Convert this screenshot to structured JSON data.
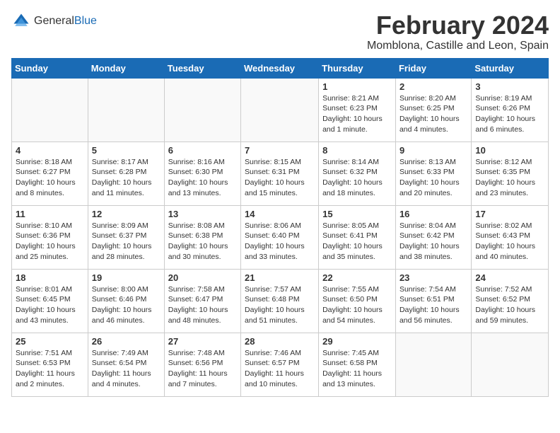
{
  "header": {
    "logo_general": "General",
    "logo_blue": "Blue",
    "month_year": "February 2024",
    "location": "Momblona, Castille and Leon, Spain"
  },
  "weekdays": [
    "Sunday",
    "Monday",
    "Tuesday",
    "Wednesday",
    "Thursday",
    "Friday",
    "Saturday"
  ],
  "weeks": [
    [
      {
        "day": "",
        "info": ""
      },
      {
        "day": "",
        "info": ""
      },
      {
        "day": "",
        "info": ""
      },
      {
        "day": "",
        "info": ""
      },
      {
        "day": "1",
        "info": "Sunrise: 8:21 AM\nSunset: 6:23 PM\nDaylight: 10 hours\nand 1 minute."
      },
      {
        "day": "2",
        "info": "Sunrise: 8:20 AM\nSunset: 6:25 PM\nDaylight: 10 hours\nand 4 minutes."
      },
      {
        "day": "3",
        "info": "Sunrise: 8:19 AM\nSunset: 6:26 PM\nDaylight: 10 hours\nand 6 minutes."
      }
    ],
    [
      {
        "day": "4",
        "info": "Sunrise: 8:18 AM\nSunset: 6:27 PM\nDaylight: 10 hours\nand 8 minutes."
      },
      {
        "day": "5",
        "info": "Sunrise: 8:17 AM\nSunset: 6:28 PM\nDaylight: 10 hours\nand 11 minutes."
      },
      {
        "day": "6",
        "info": "Sunrise: 8:16 AM\nSunset: 6:30 PM\nDaylight: 10 hours\nand 13 minutes."
      },
      {
        "day": "7",
        "info": "Sunrise: 8:15 AM\nSunset: 6:31 PM\nDaylight: 10 hours\nand 15 minutes."
      },
      {
        "day": "8",
        "info": "Sunrise: 8:14 AM\nSunset: 6:32 PM\nDaylight: 10 hours\nand 18 minutes."
      },
      {
        "day": "9",
        "info": "Sunrise: 8:13 AM\nSunset: 6:33 PM\nDaylight: 10 hours\nand 20 minutes."
      },
      {
        "day": "10",
        "info": "Sunrise: 8:12 AM\nSunset: 6:35 PM\nDaylight: 10 hours\nand 23 minutes."
      }
    ],
    [
      {
        "day": "11",
        "info": "Sunrise: 8:10 AM\nSunset: 6:36 PM\nDaylight: 10 hours\nand 25 minutes."
      },
      {
        "day": "12",
        "info": "Sunrise: 8:09 AM\nSunset: 6:37 PM\nDaylight: 10 hours\nand 28 minutes."
      },
      {
        "day": "13",
        "info": "Sunrise: 8:08 AM\nSunset: 6:38 PM\nDaylight: 10 hours\nand 30 minutes."
      },
      {
        "day": "14",
        "info": "Sunrise: 8:06 AM\nSunset: 6:40 PM\nDaylight: 10 hours\nand 33 minutes."
      },
      {
        "day": "15",
        "info": "Sunrise: 8:05 AM\nSunset: 6:41 PM\nDaylight: 10 hours\nand 35 minutes."
      },
      {
        "day": "16",
        "info": "Sunrise: 8:04 AM\nSunset: 6:42 PM\nDaylight: 10 hours\nand 38 minutes."
      },
      {
        "day": "17",
        "info": "Sunrise: 8:02 AM\nSunset: 6:43 PM\nDaylight: 10 hours\nand 40 minutes."
      }
    ],
    [
      {
        "day": "18",
        "info": "Sunrise: 8:01 AM\nSunset: 6:45 PM\nDaylight: 10 hours\nand 43 minutes."
      },
      {
        "day": "19",
        "info": "Sunrise: 8:00 AM\nSunset: 6:46 PM\nDaylight: 10 hours\nand 46 minutes."
      },
      {
        "day": "20",
        "info": "Sunrise: 7:58 AM\nSunset: 6:47 PM\nDaylight: 10 hours\nand 48 minutes."
      },
      {
        "day": "21",
        "info": "Sunrise: 7:57 AM\nSunset: 6:48 PM\nDaylight: 10 hours\nand 51 minutes."
      },
      {
        "day": "22",
        "info": "Sunrise: 7:55 AM\nSunset: 6:50 PM\nDaylight: 10 hours\nand 54 minutes."
      },
      {
        "day": "23",
        "info": "Sunrise: 7:54 AM\nSunset: 6:51 PM\nDaylight: 10 hours\nand 56 minutes."
      },
      {
        "day": "24",
        "info": "Sunrise: 7:52 AM\nSunset: 6:52 PM\nDaylight: 10 hours\nand 59 minutes."
      }
    ],
    [
      {
        "day": "25",
        "info": "Sunrise: 7:51 AM\nSunset: 6:53 PM\nDaylight: 11 hours\nand 2 minutes."
      },
      {
        "day": "26",
        "info": "Sunrise: 7:49 AM\nSunset: 6:54 PM\nDaylight: 11 hours\nand 4 minutes."
      },
      {
        "day": "27",
        "info": "Sunrise: 7:48 AM\nSunset: 6:56 PM\nDaylight: 11 hours\nand 7 minutes."
      },
      {
        "day": "28",
        "info": "Sunrise: 7:46 AM\nSunset: 6:57 PM\nDaylight: 11 hours\nand 10 minutes."
      },
      {
        "day": "29",
        "info": "Sunrise: 7:45 AM\nSunset: 6:58 PM\nDaylight: 11 hours\nand 13 minutes."
      },
      {
        "day": "",
        "info": ""
      },
      {
        "day": "",
        "info": ""
      }
    ]
  ]
}
